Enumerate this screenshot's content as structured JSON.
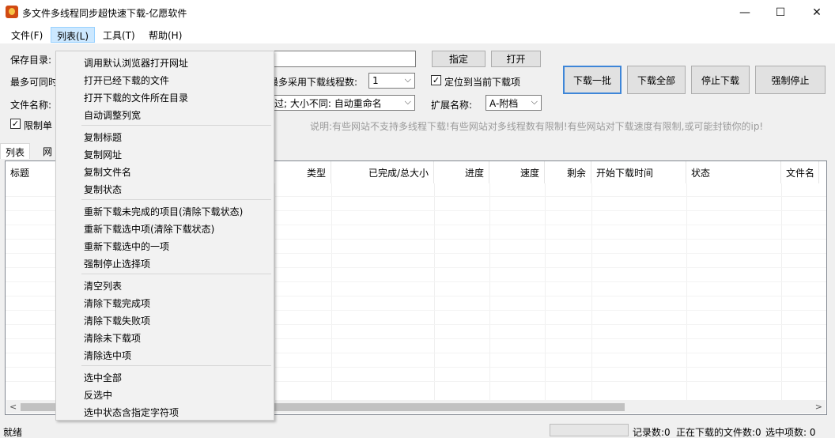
{
  "window": {
    "title": "多文件多线程同步超快速下载-亿愿软件",
    "min_glyph": "—",
    "max_glyph": "☐",
    "close_glyph": "✕"
  },
  "menubar": {
    "file": "文件(F)",
    "list": "列表(L)",
    "tools": "工具(T)",
    "help": "帮助(H)"
  },
  "form": {
    "save_dir_label": "保存目录:",
    "max_at_once_label": "最多可同时",
    "filename_label": "文件名称:",
    "limit_single_label": "限制单",
    "specify_button": "指定",
    "open_button": "打开",
    "max_threads_label": "最多采用下载线程数:",
    "threads_value": "1",
    "locate_current_label": "定位到当前下载项",
    "conflict_value": "跳过; 大小不同: 自动重命名",
    "ext_label": "扩展名称:",
    "ext_value": "A-附档",
    "hint": "说明:有些网站不支持多线程下载!有些网站对多线程数有限制!有些网站对下载速度有限制,或可能封锁你的ip!"
  },
  "actions": {
    "download_batch": "下载一批",
    "download_all": "下载全部",
    "stop_download": "停止下载",
    "force_stop": "强制停止"
  },
  "tabs": {
    "list": "列表",
    "web": "网"
  },
  "table": {
    "columns": [
      "标题",
      "类型",
      "已完成/总大小",
      "进度",
      "速度",
      "剩余",
      "开始下载时间",
      "状态",
      "文件名"
    ]
  },
  "statusbar": {
    "ready": "就绪",
    "records": "记录数:0",
    "downloading": "正在下载的文件数:0",
    "selected": "选中项数: 0"
  },
  "dropdown": {
    "groups": [
      [
        "调用默认浏览器打开网址",
        "打开已经下载的文件",
        "打开下载的文件所在目录",
        "自动调整列宽"
      ],
      [
        "复制标题",
        "复制网址",
        "复制文件名",
        "复制状态"
      ],
      [
        "重新下载未完成的项目(清除下载状态)",
        "重新下载选中项(清除下载状态)",
        "重新下载选中的一项",
        "强制停止选择项"
      ],
      [
        "清空列表",
        "清除下载完成项",
        "清除下载失败项",
        "清除未下载项",
        "清除选中项"
      ],
      [
        "选中全部",
        "反选中",
        "选中状态含指定字符项"
      ]
    ]
  },
  "colors": {
    "menu_highlight": "#cce8ff",
    "focus_border": "#3e86d8",
    "hint_text": "#9a9a9a"
  },
  "icons": {
    "app": "app-logo-icon",
    "check": "✓",
    "chevron": "⌵",
    "scroll_left": "<",
    "scroll_right": ">"
  }
}
